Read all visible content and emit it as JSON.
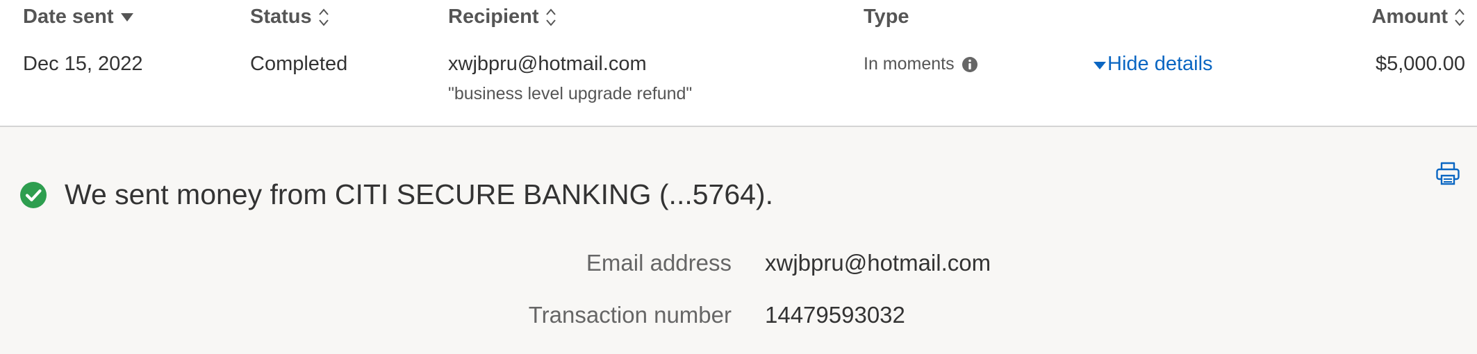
{
  "table": {
    "headers": {
      "date_sent": "Date sent",
      "status": "Status",
      "recipient": "Recipient",
      "type": "Type",
      "amount": "Amount"
    },
    "row": {
      "date": "Dec 15, 2022",
      "status": "Completed",
      "recipient": "xwjbpru@hotmail.com",
      "memo": "\"business level upgrade refund\"",
      "type": "In moments",
      "toggle_label": "Hide details",
      "amount": "$5,000.00"
    }
  },
  "details": {
    "message": "We sent money from CITI SECURE BANKING (...5764).",
    "fields": {
      "email_label": "Email address",
      "email_value": "xwjbpru@hotmail.com",
      "txn_label": "Transaction number",
      "txn_value": "14479593032"
    }
  },
  "colors": {
    "link": "#0a66c2",
    "success": "#2e9e4f",
    "panel_bg": "#f8f7f5"
  },
  "icons": {
    "sort_desc": "sort-down-icon",
    "sort_both": "sort-updown-icon",
    "info": "info-icon",
    "caret": "caret-down-icon",
    "check": "check-circle-icon",
    "print": "printer-icon"
  }
}
